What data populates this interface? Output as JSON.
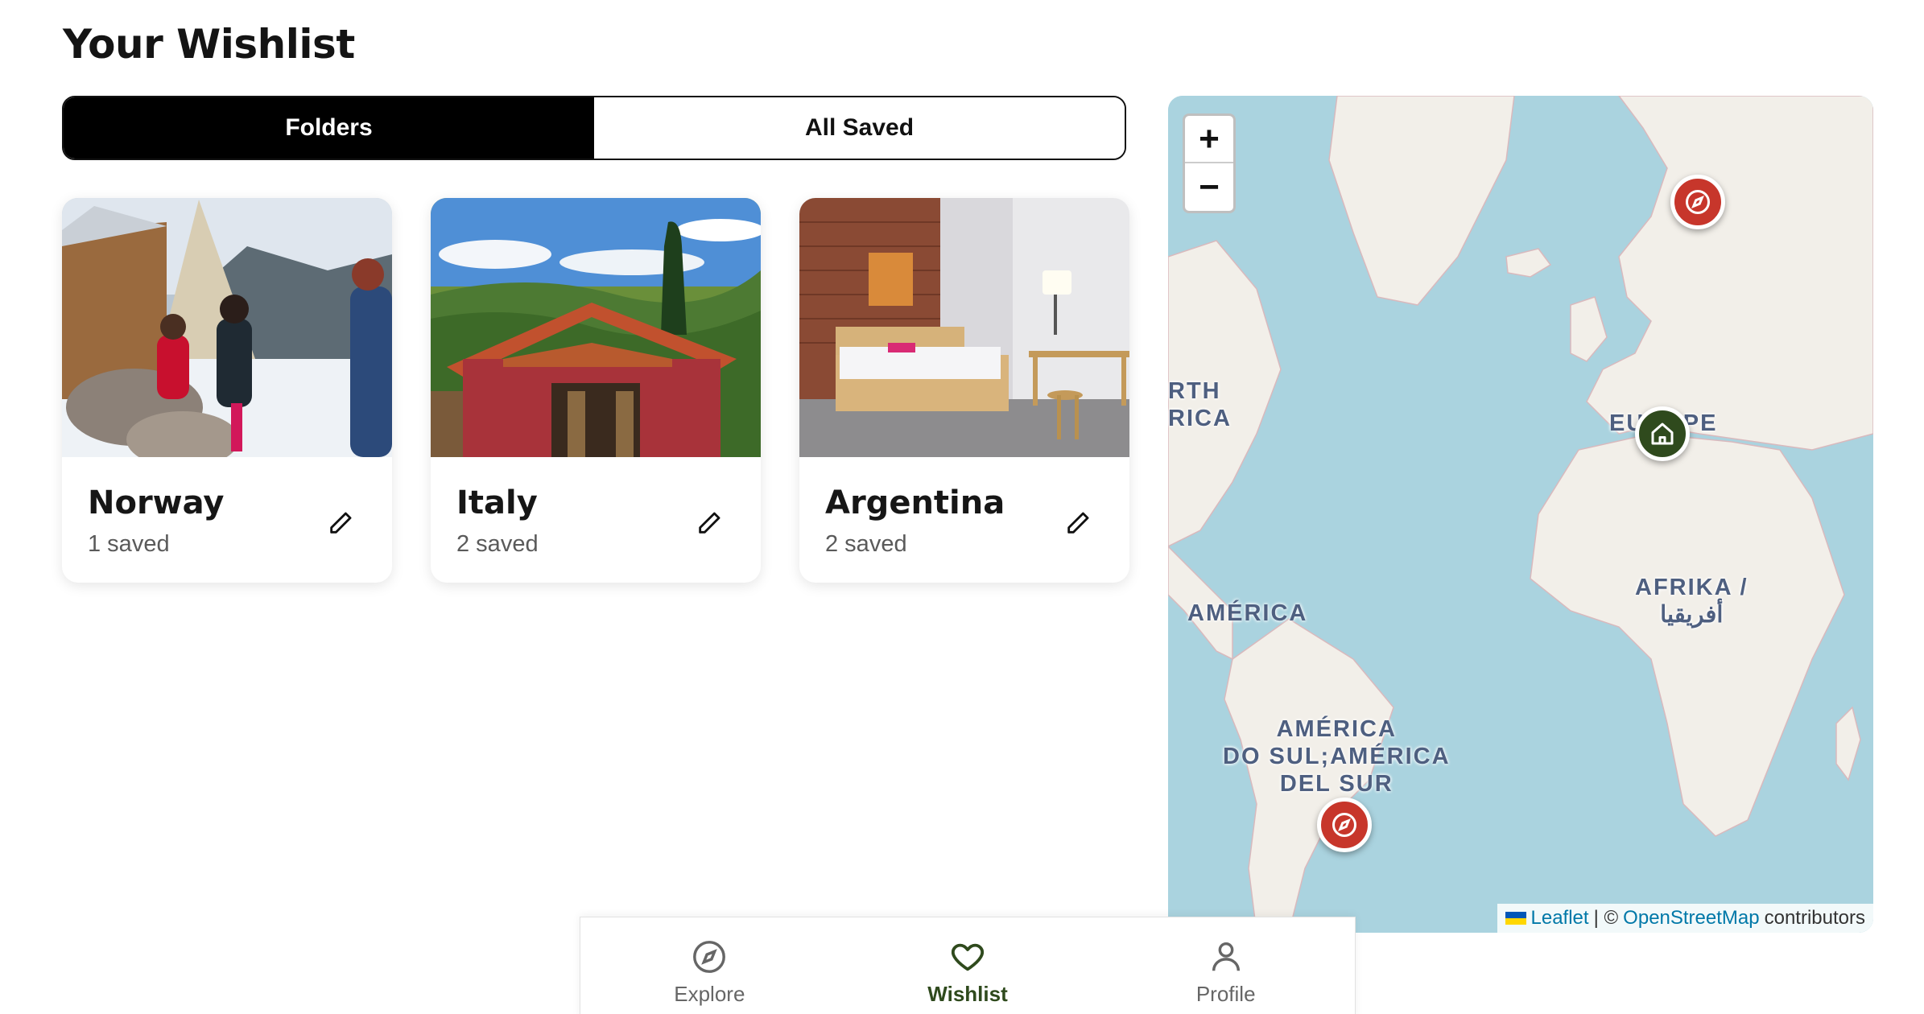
{
  "page": {
    "title": "Your Wishlist"
  },
  "toggle": {
    "folders_label": "Folders",
    "all_saved_label": "All Saved",
    "active": "folders"
  },
  "folders": [
    {
      "name": "Norway",
      "count": "1 saved"
    },
    {
      "name": "Italy",
      "count": "2 saved"
    },
    {
      "name": "Argentina",
      "count": "2 saved"
    }
  ],
  "map": {
    "zoom_in": "+",
    "zoom_out": "−",
    "labels": {
      "north_america": "RTH\nRICA",
      "europe": "EUROPE",
      "america": "AMÉRICA",
      "south_america": "AMÉRICA\nDO SUL;AMÉRICA\nDEL SUR",
      "africa": "AFRIKA /\nأفريقيا"
    },
    "pins": [
      {
        "name": "norway-pin",
        "kind": "compass",
        "color": "#c7362b"
      },
      {
        "name": "home-pin",
        "kind": "home",
        "color": "#2f4a1d"
      },
      {
        "name": "argentina-pin",
        "kind": "compass",
        "color": "#c7362b"
      }
    ],
    "attribution": {
      "leaflet": "Leaflet",
      "separator": "| ©",
      "osm": "OpenStreetMap",
      "suffix": "contributors"
    }
  },
  "nav": {
    "items": [
      {
        "label": "Explore",
        "icon": "compass-icon"
      },
      {
        "label": "Wishlist",
        "icon": "heart-icon"
      },
      {
        "label": "Profile",
        "icon": "person-icon"
      }
    ],
    "active": "Wishlist"
  },
  "colors": {
    "accent": "#2f4a1d",
    "pin_red": "#c7362b",
    "map_water": "#aad3df",
    "map_land": "#f2efe9"
  }
}
